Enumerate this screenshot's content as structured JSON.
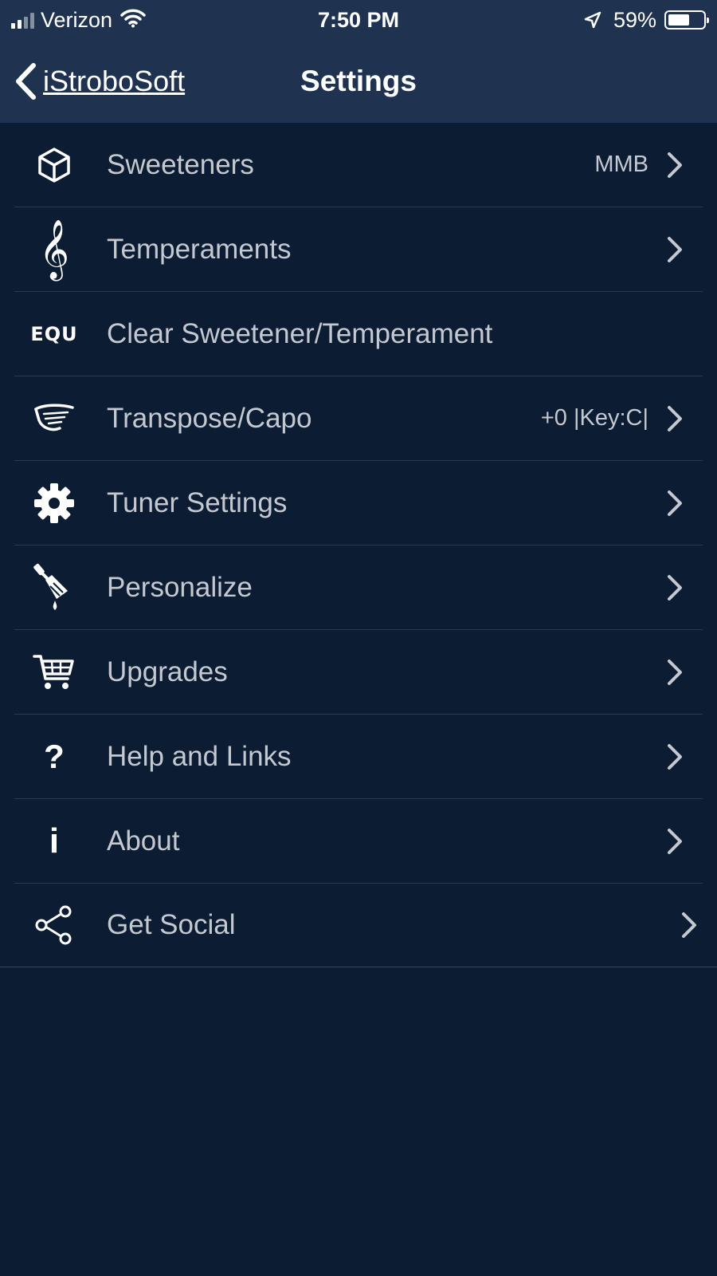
{
  "status_bar": {
    "carrier": "Verizon",
    "time": "7:50 PM",
    "battery_percent": "59%",
    "battery_level": 0.59,
    "signal_bars": 2,
    "icons": [
      "signal-icon",
      "wifi-icon",
      "location-arrow-icon",
      "battery-icon"
    ]
  },
  "nav": {
    "back_label": "iStroboSoft",
    "title": "Settings"
  },
  "settings": [
    {
      "label": "Sweeteners",
      "value": "MMB",
      "icon": "cube-icon",
      "chevron": true
    },
    {
      "label": "Temperaments",
      "value": "",
      "icon": "treble-clef-icon",
      "chevron": true
    },
    {
      "label": "Clear Sweetener/Temperament",
      "value": "",
      "icon": "equ-icon",
      "icon_text": "EQU",
      "chevron": false
    },
    {
      "label": "Transpose/Capo",
      "value": "+0 |Key:C|",
      "icon": "capo-icon",
      "chevron": true
    },
    {
      "label": "Tuner Settings",
      "value": "",
      "icon": "gear-icon",
      "chevron": true
    },
    {
      "label": "Personalize",
      "value": "",
      "icon": "paintbrush-icon",
      "chevron": true
    },
    {
      "label": "Upgrades",
      "value": "",
      "icon": "shopping-cart-icon",
      "chevron": true
    },
    {
      "label": "Help and Links",
      "value": "",
      "icon": "question-icon",
      "icon_text": "?",
      "chevron": true
    },
    {
      "label": "About",
      "value": "",
      "icon": "info-icon",
      "icon_text": "i",
      "chevron": true
    },
    {
      "label": "Get Social",
      "value": "",
      "icon": "share-icon",
      "chevron": true
    }
  ],
  "colors": {
    "background": "#0b1c33",
    "header": "#1f3350",
    "text": "#c4c9d1",
    "divider": "#2a3a50"
  }
}
